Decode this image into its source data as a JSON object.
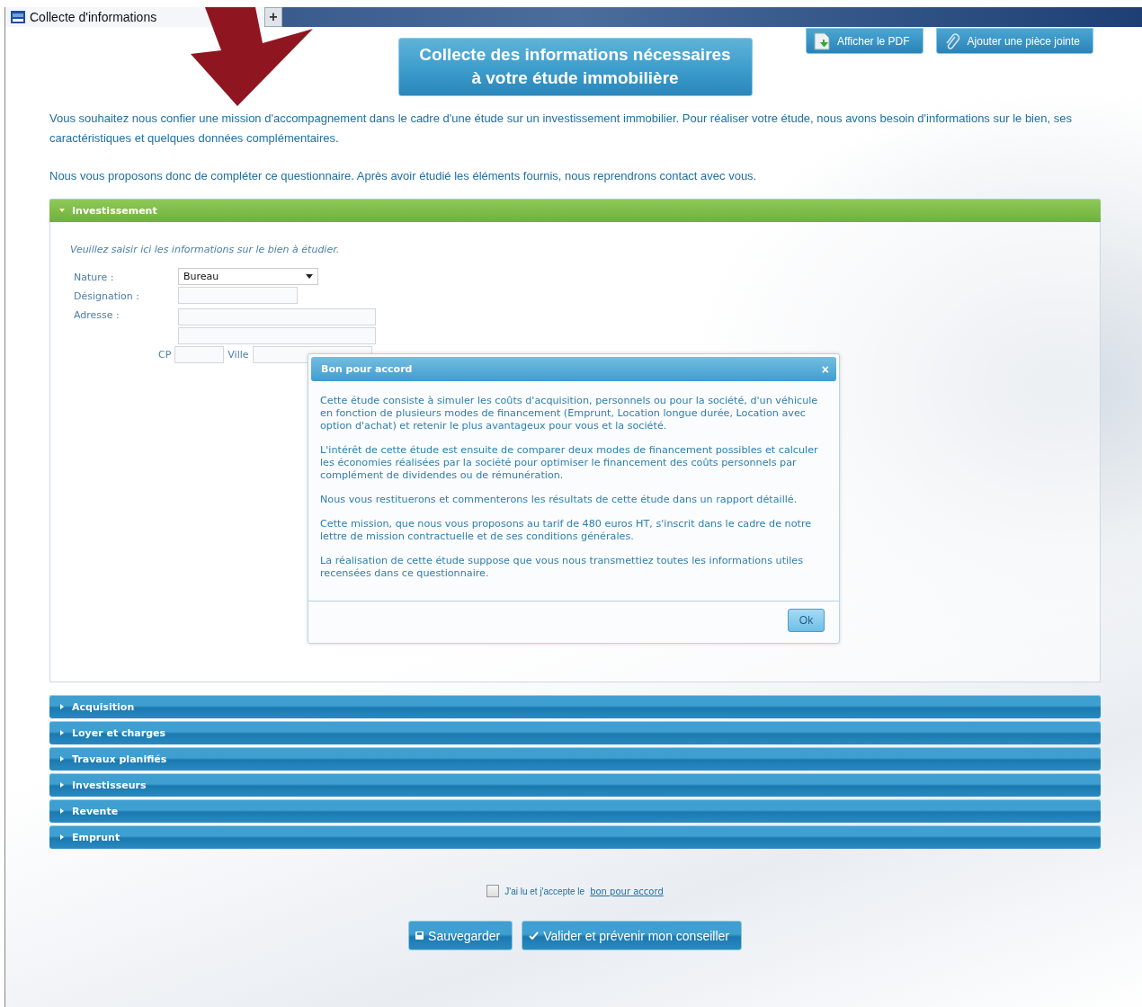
{
  "browser_tab": {
    "title": "Collecte d'informations",
    "new_tab": "+"
  },
  "header": {
    "title_lines": [
      "Collecte des informations nécessaires",
      "à votre étude immobilière"
    ],
    "actions": [
      {
        "kind": "pdf",
        "label": "Afficher le PDF"
      },
      {
        "kind": "attach",
        "label": "Ajouter une pièce jointe"
      }
    ]
  },
  "intro": [
    "Vous souhaitez nous confier une mission d'accompagnement dans le cadre d'une étude sur un investissement immobilier. Pour réaliser votre étude, nous avons besoin d'informations sur le bien, ses caractéristiques et quelques données complémentaires.",
    "Nous vous proposons donc de compléter ce questionnaire. Après avoir étudié les éléments fournis, nous reprendrons contact avec vous."
  ],
  "sections": [
    {
      "title": "Investissement",
      "expanded": true,
      "hint": "Veuillez saisir ici les informations sur le bien à étudier.",
      "fields": {
        "nature_label": "Nature :",
        "nature_value": "Bureau",
        "designation_label": "Désignation :",
        "adresse_label": "Adresse :",
        "cp_label": "CP",
        "ville_label": "Ville"
      }
    },
    {
      "title": "Acquisition",
      "expanded": false
    },
    {
      "title": "Loyer et charges",
      "expanded": false
    },
    {
      "title": "Travaux planifiés",
      "expanded": false
    },
    {
      "title": "Investisseurs",
      "expanded": false
    },
    {
      "title": "Revente",
      "expanded": false
    },
    {
      "title": "Emprunt",
      "expanded": false
    }
  ],
  "dialog": {
    "title": "Bon pour accord",
    "close": "×",
    "paragraphs": [
      "Cette étude consiste à simuler les coûts d'acquisition, personnels ou pour la société, d'un véhicule en fonction de plusieurs modes de financement (Emprunt, Location longue durée, Location avec option d'achat) et retenir le plus avantageux pour vous et la société.",
      "L'intérêt de cette étude est ensuite de comparer deux modes de financement possibles et calculer les économies réalisées par la société pour optimiser le financement des coûts personnels par complément de dividendes ou de rémunération.",
      "Nous vous restituerons et commenterons les résultats de cette étude dans un rapport détaillé.",
      "Cette mission, que nous vous proposons au tarif de 480 euros HT, s'inscrit dans le cadre de notre lettre de mission contractuelle et de ses conditions générales.",
      "La réalisation de cette étude suppose que vous nous transmettiez toutes les informations utiles recensées dans ce questionnaire."
    ],
    "ok": "Ok"
  },
  "agreement": {
    "checked": false,
    "text": "J'ai lu et j'accepte le",
    "link": "bon pour accord"
  },
  "buttons": [
    {
      "kind": "save",
      "label": "Sauvegarder"
    },
    {
      "kind": "validate",
      "label": "Valider et prévenir mon conseiller"
    }
  ]
}
